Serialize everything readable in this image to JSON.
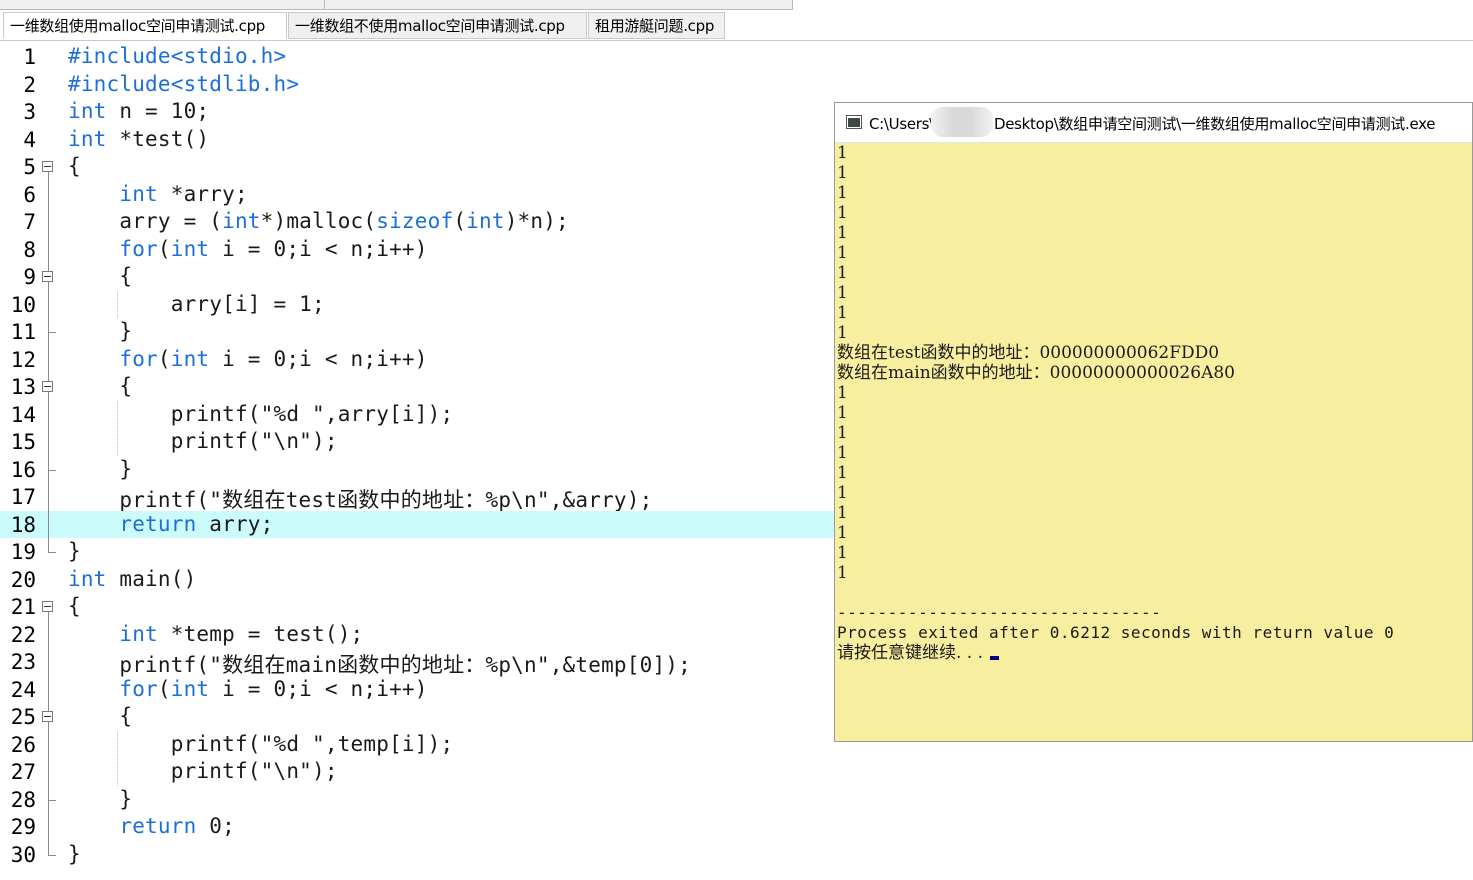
{
  "tabs": [
    {
      "label": "一维数组使用malloc空间申请测试.cpp",
      "active": true
    },
    {
      "label": "一维数组不使用malloc空间申请测试.cpp",
      "active": false
    },
    {
      "label": "租用游艇问题.cpp",
      "active": false
    }
  ],
  "editor": {
    "current_line": 18,
    "lines": [
      {
        "n": "1",
        "html": "<span class='pp'>#include&lt;stdio.h&gt;</span>"
      },
      {
        "n": "2",
        "html": "<span class='pp'>#include&lt;stdlib.h&gt;</span>"
      },
      {
        "n": "3",
        "html": "<span class='kw'>int</span> n = 10;"
      },
      {
        "n": "4",
        "html": "<span class='kw'>int</span> *test()"
      },
      {
        "n": "5",
        "html": "{"
      },
      {
        "n": "6",
        "html": "    <span class='kw'>int</span> *arry;"
      },
      {
        "n": "7",
        "html": "    arry = (<span class='kw'>int</span>*)malloc(<span class='kw'>sizeof</span>(<span class='kw'>int</span>)*n);"
      },
      {
        "n": "8",
        "html": "    <span class='kw'>for</span>(<span class='kw'>int</span> i = 0;i &lt; n;i++)"
      },
      {
        "n": "9",
        "html": "    {"
      },
      {
        "n": "10",
        "html": "        arry[i] = 1;"
      },
      {
        "n": "11",
        "html": "    }"
      },
      {
        "n": "12",
        "html": "    <span class='kw'>for</span>(<span class='kw'>int</span> i = 0;i &lt; n;i++)"
      },
      {
        "n": "13",
        "html": "    {"
      },
      {
        "n": "14",
        "html": "        printf(\"%d \",arry[i]);"
      },
      {
        "n": "15",
        "html": "        printf(\"\\n\");"
      },
      {
        "n": "16",
        "html": "    }"
      },
      {
        "n": "17",
        "html": "    printf(\"数组在test函数中的地址：%p\\n\",&amp;arry);"
      },
      {
        "n": "18",
        "html": "    <span class='kw'>return</span> arry;"
      },
      {
        "n": "19",
        "html": "}"
      },
      {
        "n": "20",
        "html": "<span class='kw'>int</span> main()"
      },
      {
        "n": "21",
        "html": "{"
      },
      {
        "n": "22",
        "html": "    <span class='kw'>int</span> *temp = test();"
      },
      {
        "n": "23",
        "html": "    printf(\"数组在main函数中的地址：%p\\n\",&amp;temp[0]);"
      },
      {
        "n": "24",
        "html": "    <span class='kw'>for</span>(<span class='kw'>int</span> i = 0;i &lt; n;i++)"
      },
      {
        "n": "25",
        "html": "    {"
      },
      {
        "n": "26",
        "html": "        printf(\"%d \",temp[i]);"
      },
      {
        "n": "27",
        "html": "        printf(\"\\n\");"
      },
      {
        "n": "28",
        "html": "    }"
      },
      {
        "n": "29",
        "html": "    <span class='kw'>return</span> 0;"
      },
      {
        "n": "30",
        "html": "}"
      }
    ],
    "fold_boxes": [
      5,
      9,
      13,
      21,
      25
    ],
    "fold_ends": [
      11,
      16,
      19,
      28,
      30
    ]
  },
  "console": {
    "title_prefix": "C:\\Users\\",
    "title_suffix": "Desktop\\数组申请空间测试\\一维数组使用malloc空间申请测试.exe",
    "output": [
      "1",
      "1",
      "1",
      "1",
      "1",
      "1",
      "1",
      "1",
      "1",
      "1",
      "数组在test函数中的地址：000000000062FDD0",
      "数组在main函数中的地址：00000000000026A80",
      "1",
      "1",
      "1",
      "1",
      "1",
      "1",
      "1",
      "1",
      "1",
      "1",
      "",
      "--------------------------------",
      "Process exited after 0.6212 seconds with return value 0",
      "请按任意键继续. . . "
    ]
  }
}
